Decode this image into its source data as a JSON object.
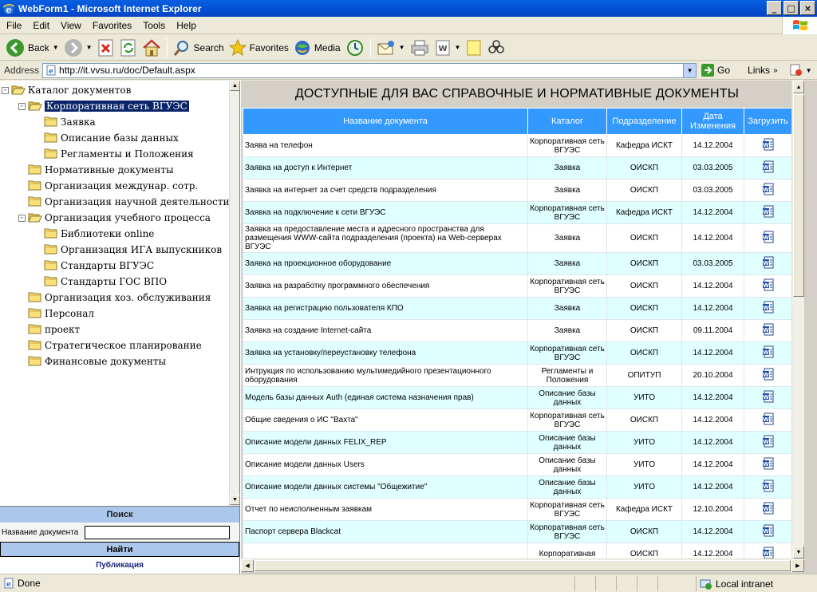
{
  "window": {
    "title": "WebForm1 - Microsoft Internet Explorer",
    "buttons": [
      "_",
      "□",
      "×"
    ]
  },
  "menu": [
    "File",
    "Edit",
    "View",
    "Favorites",
    "Tools",
    "Help"
  ],
  "toolbar": {
    "back": "Back",
    "search": "Search",
    "favorites": "Favorites",
    "media": "Media"
  },
  "address": {
    "label": "Address",
    "url": "http://it.vvsu.ru/doc/Default.aspx",
    "go": "Go",
    "links": "Links"
  },
  "tree": [
    {
      "label": "Каталог документов",
      "level": 0,
      "expander": "-",
      "open": true,
      "selected": false
    },
    {
      "label": "Корпоративная сеть ВГУЭС",
      "level": 1,
      "expander": "-",
      "open": true,
      "selected": true
    },
    {
      "label": "Заявка",
      "level": 2,
      "expander": "",
      "open": false,
      "selected": false
    },
    {
      "label": "Описание базы данных",
      "level": 2,
      "expander": "",
      "open": false,
      "selected": false
    },
    {
      "label": "Регламенты и Положения",
      "level": 2,
      "expander": "",
      "open": false,
      "selected": false
    },
    {
      "label": "Нормативные документы",
      "level": 1,
      "expander": "",
      "open": false,
      "selected": false
    },
    {
      "label": "Организация междунар. сотр.",
      "level": 1,
      "expander": "",
      "open": false,
      "selected": false
    },
    {
      "label": "Организация научной деятельности",
      "level": 1,
      "expander": "",
      "open": false,
      "selected": false
    },
    {
      "label": "Организация учебного процесса",
      "level": 1,
      "expander": "-",
      "open": true,
      "selected": false
    },
    {
      "label": "Библиотеки online",
      "level": 2,
      "expander": "",
      "open": false,
      "selected": false
    },
    {
      "label": "Организация ИГА выпускников",
      "level": 2,
      "expander": "",
      "open": false,
      "selected": false
    },
    {
      "label": "Стандарты ВГУЭС",
      "level": 2,
      "expander": "",
      "open": false,
      "selected": false
    },
    {
      "label": "Стандарты ГОС ВПО",
      "level": 2,
      "expander": "",
      "open": false,
      "selected": false
    },
    {
      "label": "Организация хоз. обслуживания",
      "level": 1,
      "expander": "",
      "open": false,
      "selected": false
    },
    {
      "label": "Персонал",
      "level": 1,
      "expander": "",
      "open": false,
      "selected": false
    },
    {
      "label": "проект",
      "level": 1,
      "expander": "",
      "open": false,
      "selected": false
    },
    {
      "label": "Стратегическое планирование",
      "level": 1,
      "expander": "",
      "open": false,
      "selected": false
    },
    {
      "label": "Финансовые документы",
      "level": 1,
      "expander": "",
      "open": false,
      "selected": false
    }
  ],
  "search": {
    "header": "Поиск",
    "field_label": "Название документа",
    "field_value": "",
    "find_button": "Найти",
    "publication_link": "Публикация"
  },
  "documents": {
    "title": "ДОСТУПНЫЕ ДЛЯ ВАС СПРАВОЧНЫЕ И НОРМАТИВНЫЕ ДОКУМЕНТЫ",
    "columns": [
      "Название документа",
      "Каталог",
      "Подразделение",
      "Дата Изменения",
      "Загрузить"
    ],
    "rows": [
      {
        "name": "Заява на телефон",
        "catalog": "Корпоративная сеть ВГУЭС",
        "dept": "Кафедра ИСКТ",
        "date": "14.12.2004"
      },
      {
        "name": "Заявка на доступ к Интернет",
        "catalog": "Заявка",
        "dept": "ОИСКП",
        "date": "03.03.2005"
      },
      {
        "name": "Заявка на интернет за счет средств подразделения",
        "catalog": "Заявка",
        "dept": "ОИСКП",
        "date": "03.03.2005"
      },
      {
        "name": "Заявка на подключение к сети ВГУЭС",
        "catalog": "Корпоративная сеть ВГУЭС",
        "dept": "Кафедра ИСКТ",
        "date": "14.12.2004"
      },
      {
        "name": "Заявка на предоставление места и адресного пространства для размещения WWW-сайта подразделения (проекта) на Web-серверах ВГУЭС",
        "catalog": "Заявка",
        "dept": "ОИСКП",
        "date": "14.12.2004"
      },
      {
        "name": "Заявка на проекционное оборудование",
        "catalog": "Заявка",
        "dept": "ОИСКП",
        "date": "03.03.2005"
      },
      {
        "name": "Заявка на разработку программного обеспечения",
        "catalog": "Корпоративная сеть ВГУЭС",
        "dept": "ОИСКП",
        "date": "14.12.2004"
      },
      {
        "name": "Заявка на регистрацию пользователя КПО",
        "catalog": "Заявка",
        "dept": "ОИСКП",
        "date": "14.12.2004"
      },
      {
        "name": "Заявка на создание Internet-сайта",
        "catalog": "Заявка",
        "dept": "ОИСКП",
        "date": "09.11.2004"
      },
      {
        "name": "Заявка на установку/переустановку телефона",
        "catalog": "Корпоративная сеть ВГУЭС",
        "dept": "ОИСКП",
        "date": "14.12.2004"
      },
      {
        "name": "Интрукция по использованию мультимедийного презентационного оборудования",
        "catalog": "Регламенты и Положения",
        "dept": "ОПИТУП",
        "date": "20.10.2004"
      },
      {
        "name": "Модель базы данных Auth (единая система назначения прав)",
        "catalog": "Описание базы данных",
        "dept": "УИТО",
        "date": "14.12.2004"
      },
      {
        "name": "Общие сведения о ИС \"Вахта\"",
        "catalog": "Корпоративная сеть ВГУЭС",
        "dept": "ОИСКП",
        "date": "14.12.2004"
      },
      {
        "name": "Описание модели данных FELIX_REP",
        "catalog": "Описание базы данных",
        "dept": "УИТО",
        "date": "14.12.2004"
      },
      {
        "name": "Описание модели данных Users",
        "catalog": "Описание базы данных",
        "dept": "УИТО",
        "date": "14.12.2004"
      },
      {
        "name": "Описание модели данных системы \"Общежитие\"",
        "catalog": "Описание базы данных",
        "dept": "УИТО",
        "date": "14.12.2004"
      },
      {
        "name": "Отчет по неисполненным заявкам",
        "catalog": "Корпоративная сеть ВГУЭС",
        "dept": "Кафедра ИСКТ",
        "date": "12.10.2004"
      },
      {
        "name": "Паспорт сервера Blackcat",
        "catalog": "Корпоративная сеть ВГУЭС",
        "dept": "ОИСКП",
        "date": "14.12.2004"
      },
      {
        "name": "",
        "catalog": "Корпоративная",
        "dept": "ОИСКП",
        "date": "14.12.2004"
      }
    ]
  },
  "status": {
    "text": "Done",
    "zone": "Local intranet"
  }
}
